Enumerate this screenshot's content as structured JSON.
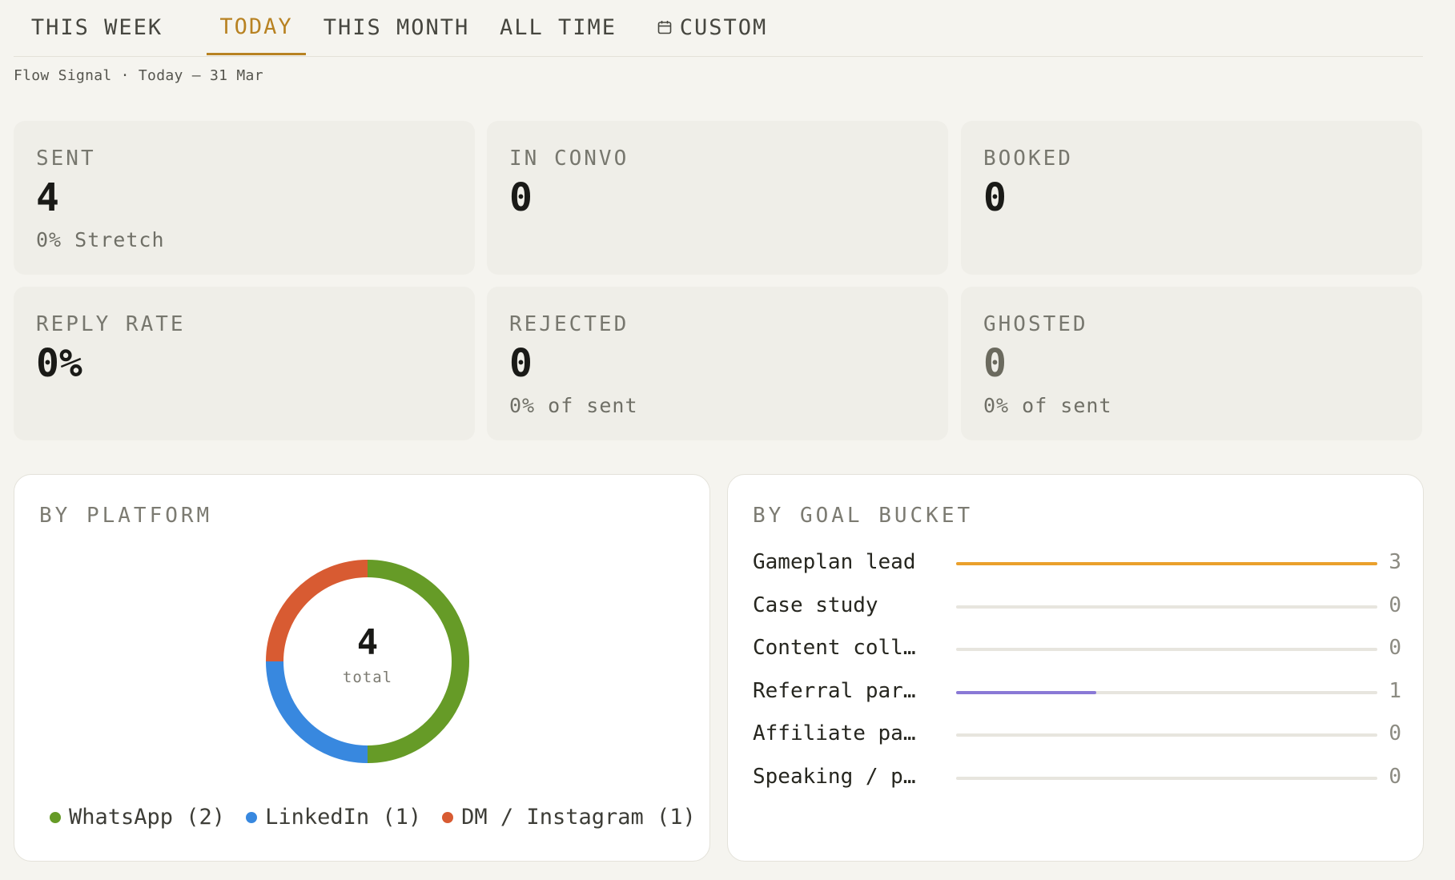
{
  "tabs": [
    {
      "label": "THIS WEEK",
      "active": false
    },
    {
      "label": "TODAY",
      "active": true
    },
    {
      "label": "THIS MONTH",
      "active": false
    },
    {
      "label": "ALL TIME",
      "active": false
    },
    {
      "label": "CUSTOM",
      "active": false,
      "icon": "calendar-icon"
    }
  ],
  "breadcrumb": "Flow Signal · Today — 31 Mar",
  "stats": {
    "sent": {
      "label": "SENT",
      "value": "4",
      "sub": "0% Stretch"
    },
    "in_convo": {
      "label": "IN CONVO",
      "value": "0"
    },
    "booked": {
      "label": "BOOKED",
      "value": "0"
    },
    "reply_rate": {
      "label": "REPLY RATE",
      "value": "0%"
    },
    "rejected": {
      "label": "REJECTED",
      "value": "0",
      "sub": "0% of sent"
    },
    "ghosted": {
      "label": "GHOSTED",
      "value": "0",
      "sub": "0% of sent"
    }
  },
  "platform": {
    "title": "BY PLATFORM",
    "total": "4",
    "total_caption": "total",
    "segments": [
      {
        "name": "WhatsApp",
        "count": 2,
        "legend": "WhatsApp (2)",
        "color": "#669b27"
      },
      {
        "name": "LinkedIn",
        "count": 1,
        "legend": "LinkedIn (1)",
        "color": "#3888df"
      },
      {
        "name": "DM / Instagram",
        "count": 1,
        "legend": "DM / Instagram (1)",
        "color": "#d85b32"
      }
    ]
  },
  "goal_bucket": {
    "title": "BY GOAL BUCKET",
    "max": 3,
    "rows": [
      {
        "label": "Gameplan lead",
        "count": "3",
        "value": 3,
        "color": "#eaa02c"
      },
      {
        "label": "Case study",
        "count": "0",
        "value": 0,
        "color": "#e7e5de"
      },
      {
        "label": "Content coll…",
        "count": "0",
        "value": 0,
        "color": "#e7e5de"
      },
      {
        "label": "Referral par…",
        "count": "1",
        "value": 1,
        "color": "#8a79d6"
      },
      {
        "label": "Affiliate pa…",
        "count": "0",
        "value": 0,
        "color": "#e7e5de"
      },
      {
        "label": "Speaking / p…",
        "count": "0",
        "value": 0,
        "color": "#e7e5de"
      }
    ]
  }
}
